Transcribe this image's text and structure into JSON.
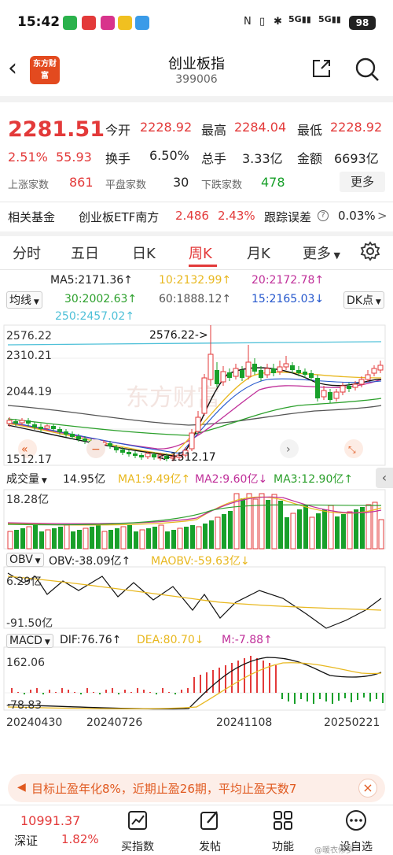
{
  "status_bar": {
    "time": "15:42",
    "battery": "98",
    "net": "5G"
  },
  "header": {
    "back": "‹",
    "logo_text": "东方财富",
    "title": "创业板指",
    "code": "399006"
  },
  "quote": {
    "price": "2281.51",
    "change_pct": "2.51%",
    "change": "55.93",
    "open_label": "今开",
    "open": "2228.92",
    "high_label": "最高",
    "high": "2284.04",
    "low_label": "最低",
    "low": "2228.92",
    "turnover_label": "换手",
    "turnover": "6.50%",
    "volume_label": "总手",
    "volume": "3.33亿",
    "amount_label": "金额",
    "amount": "6693亿",
    "up_label": "上涨家数",
    "up": "861",
    "flat_label": "平盘家数",
    "flat": "30",
    "down_label": "下跌家数",
    "down": "478",
    "more": "更多"
  },
  "fund": {
    "label": "相关基金",
    "name": "创业板ETF南方",
    "price": "2.486",
    "pct": "2.43%",
    "track_label": "跟踪误差",
    "track_value": "0.03%",
    "arrow": ">"
  },
  "tabs": [
    "分时",
    "五日",
    "日K",
    "周K",
    "月K",
    "更多"
  ],
  "ma": {
    "select": "均线",
    "ma5": "MA5:2171.36↑",
    "ma10": "10:2132.99↑",
    "ma20": "20:2172.78↑",
    "ma30": "30:2002.63↑",
    "ma60": "60:1888.12↑",
    "ma15": "15:2165.03↓",
    "ma250": "250:2457.02↑",
    "dk": "DK点"
  },
  "price_axis": {
    "top": "2576.22",
    "mid": "2310.21",
    "low": "2044.19",
    "bottom": "1512.17",
    "max_marker": "2576.22->",
    "min_marker": "<-1512.17"
  },
  "volume": {
    "select": "成交量",
    "value": "14.95亿",
    "ma1": "MA1:9.49亿↑",
    "ma2": "MA2:9.60亿↓",
    "ma3": "MA3:12.90亿↑",
    "axis_top": "18.28亿"
  },
  "obv": {
    "select": "OBV",
    "value": "OBV:-38.09亿↑",
    "maobv": "MAOBV:-59.63亿↓",
    "axis_top": "6.29亿",
    "axis_bottom": "-91.50亿"
  },
  "macd": {
    "select": "MACD",
    "dif": "DIF:76.76↑",
    "dea": "DEA:80.70↓",
    "m": "M:-7.88↑",
    "axis_top": "162.06",
    "axis_bottom": "-78.83"
  },
  "dates": [
    "20240430",
    "20240726",
    "20241108",
    "20250221"
  ],
  "banner": {
    "text": "目标止盈年化8%，近期止盈26期，平均止盈天数7"
  },
  "bottom_nav": {
    "index_value": "10991.37",
    "index_name": "深证",
    "index_pct": "1.82%",
    "items": [
      "买指数",
      "发帖",
      "功能",
      "设自选"
    ]
  },
  "watermark": "@暖衣修罗",
  "colors": {
    "up": "#e33a3a",
    "down": "#18a02a",
    "ma5": "#111111",
    "ma10": "#e8b820",
    "ma20": "#c0309a",
    "ma30": "#2ca02c",
    "ma60": "#555555",
    "ma15": "#2255cc",
    "ma250": "#4ec0d8"
  }
}
